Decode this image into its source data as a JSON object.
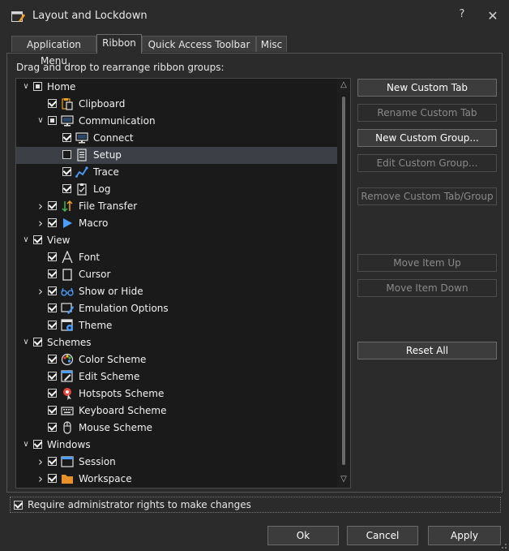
{
  "window": {
    "title": "Layout and Lockdown",
    "help": "?",
    "close": "✕"
  },
  "tabs": [
    {
      "label": "Application Menu",
      "active": false
    },
    {
      "label": "Ribbon",
      "active": true
    },
    {
      "label": "Quick Access Toolbar",
      "active": false
    },
    {
      "label": "Misc",
      "active": false
    }
  ],
  "instruction": "Drag and drop to rearrange ribbon groups:",
  "tree": [
    {
      "label": "Home",
      "expander": "open",
      "check": "partial",
      "icon": ""
    },
    {
      "label": "Clipboard",
      "expander": "",
      "check": "checked",
      "icon": "clipboard-icon"
    },
    {
      "label": "Communication",
      "expander": "open",
      "check": "partial",
      "icon": "monitor-icon"
    },
    {
      "label": "Connect",
      "expander": "",
      "check": "checked",
      "icon": "monitor-icon"
    },
    {
      "label": "Setup",
      "expander": "",
      "check": "unchecked",
      "icon": "setup-icon",
      "selected": true
    },
    {
      "label": "Trace",
      "expander": "",
      "check": "checked",
      "icon": "trace-icon"
    },
    {
      "label": "Log",
      "expander": "",
      "check": "checked",
      "icon": "log-icon"
    },
    {
      "label": "File Transfer",
      "expander": "closed",
      "check": "checked",
      "icon": "transfer-icon"
    },
    {
      "label": "Macro",
      "expander": "closed",
      "check": "checked",
      "icon": "play-icon"
    },
    {
      "label": "View",
      "expander": "open",
      "check": "checked",
      "icon": ""
    },
    {
      "label": "Font",
      "expander": "",
      "check": "checked",
      "icon": "font-icon"
    },
    {
      "label": "Cursor",
      "expander": "",
      "check": "checked",
      "icon": "cursor-icon"
    },
    {
      "label": "Show or Hide",
      "expander": "closed",
      "check": "checked",
      "icon": "glasses-icon"
    },
    {
      "label": "Emulation Options",
      "expander": "",
      "check": "checked",
      "icon": "emulation-icon"
    },
    {
      "label": "Theme",
      "expander": "",
      "check": "checked",
      "icon": "theme-icon"
    },
    {
      "label": "Schemes",
      "expander": "open",
      "check": "checked",
      "icon": ""
    },
    {
      "label": "Color Scheme",
      "expander": "",
      "check": "checked",
      "icon": "palette-icon"
    },
    {
      "label": "Edit Scheme",
      "expander": "",
      "check": "checked",
      "icon": "edit-scheme-icon"
    },
    {
      "label": "Hotspots Scheme",
      "expander": "",
      "check": "checked",
      "icon": "hotspot-icon"
    },
    {
      "label": "Keyboard Scheme",
      "expander": "",
      "check": "checked",
      "icon": "keyboard-icon"
    },
    {
      "label": "Mouse Scheme",
      "expander": "",
      "check": "checked",
      "icon": "mouse-icon"
    },
    {
      "label": "Windows",
      "expander": "open",
      "check": "checked",
      "icon": ""
    },
    {
      "label": "Session",
      "expander": "closed",
      "check": "checked",
      "icon": "session-icon"
    },
    {
      "label": "Workspace",
      "expander": "closed",
      "check": "checked",
      "icon": "folder-icon"
    }
  ],
  "side_buttons": [
    {
      "label": "New Custom Tab",
      "enabled": true
    },
    {
      "label": "Rename Custom Tab",
      "enabled": false
    },
    {
      "label": "New Custom Group...",
      "enabled": true
    },
    {
      "label": "Edit Custom Group...",
      "enabled": false
    },
    {
      "label": "Remove Custom Tab/Group",
      "enabled": false
    },
    {
      "label": "Move Item Up",
      "enabled": false
    },
    {
      "label": "Move Item Down",
      "enabled": false
    },
    {
      "label": "Reset All",
      "enabled": true
    }
  ],
  "admin": {
    "label": "Require administrator rights to make changes",
    "checked": true
  },
  "footer": {
    "ok": "Ok",
    "cancel": "Cancel",
    "apply": "Apply"
  },
  "colors": {
    "background": "#2b2b2b",
    "tree_background": "#1a1a1a",
    "selection": "#3c3f45",
    "accent_blue": "#4a9eff",
    "folder_orange": "#e8902a"
  }
}
